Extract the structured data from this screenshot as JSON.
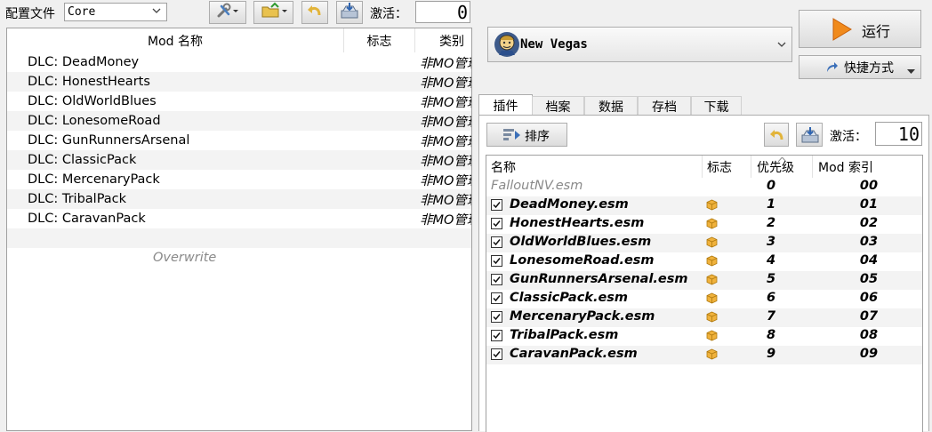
{
  "left_toolbar": {
    "profile_label": "配置文件",
    "profile_value": "Core",
    "active_label": "激活：",
    "active_count": "0"
  },
  "mod_list": {
    "columns": [
      "Mod 名称",
      "标志",
      "类别"
    ],
    "rows": [
      {
        "name": "DLC: DeadMoney",
        "category": "非MO管理"
      },
      {
        "name": "DLC: HonestHearts",
        "category": "非MO管理"
      },
      {
        "name": "DLC: OldWorldBlues",
        "category": "非MO管理"
      },
      {
        "name": "DLC: LonesomeRoad",
        "category": "非MO管理"
      },
      {
        "name": "DLC: GunRunnersArsenal",
        "category": "非MO管理"
      },
      {
        "name": "DLC: ClassicPack",
        "category": "非MO管理"
      },
      {
        "name": "DLC: MercenaryPack",
        "category": "非MO管理"
      },
      {
        "name": "DLC: TribalPack",
        "category": "非MO管理"
      },
      {
        "name": "DLC: CaravanPack",
        "category": "非MO管理"
      }
    ],
    "overwrite": "Overwrite"
  },
  "executable": {
    "name": "New Vegas"
  },
  "run_label": "运行",
  "shortcut_label": "快捷方式",
  "tabs": [
    "插件",
    "档案",
    "数据",
    "存档",
    "下载"
  ],
  "plugin_toolbar": {
    "sort_label": "排序",
    "active_label": "激活：",
    "active_count": "10"
  },
  "plugin_list": {
    "columns": [
      "名称",
      "标志",
      "优先级",
      "Mod 索引"
    ],
    "rows": [
      {
        "name": "FalloutNV.esm",
        "priority": "0",
        "index": "00",
        "checked": false,
        "locked": true
      },
      {
        "name": "DeadMoney.esm",
        "priority": "1",
        "index": "01",
        "checked": true,
        "locked": false
      },
      {
        "name": "HonestHearts.esm",
        "priority": "2",
        "index": "02",
        "checked": true,
        "locked": false
      },
      {
        "name": "OldWorldBlues.esm",
        "priority": "3",
        "index": "03",
        "checked": true,
        "locked": false
      },
      {
        "name": "LonesomeRoad.esm",
        "priority": "4",
        "index": "04",
        "checked": true,
        "locked": false
      },
      {
        "name": "GunRunnersArsenal.esm",
        "priority": "5",
        "index": "05",
        "checked": true,
        "locked": false
      },
      {
        "name": "ClassicPack.esm",
        "priority": "6",
        "index": "06",
        "checked": true,
        "locked": false
      },
      {
        "name": "MercenaryPack.esm",
        "priority": "7",
        "index": "07",
        "checked": true,
        "locked": false
      },
      {
        "name": "TribalPack.esm",
        "priority": "8",
        "index": "08",
        "checked": true,
        "locked": false
      },
      {
        "name": "CaravanPack.esm",
        "priority": "9",
        "index": "09",
        "checked": true,
        "locked": false
      }
    ]
  },
  "colors": {
    "accent": "#e8731c",
    "flag": "#f0b23c",
    "locked_text": "#8a8a8a"
  }
}
